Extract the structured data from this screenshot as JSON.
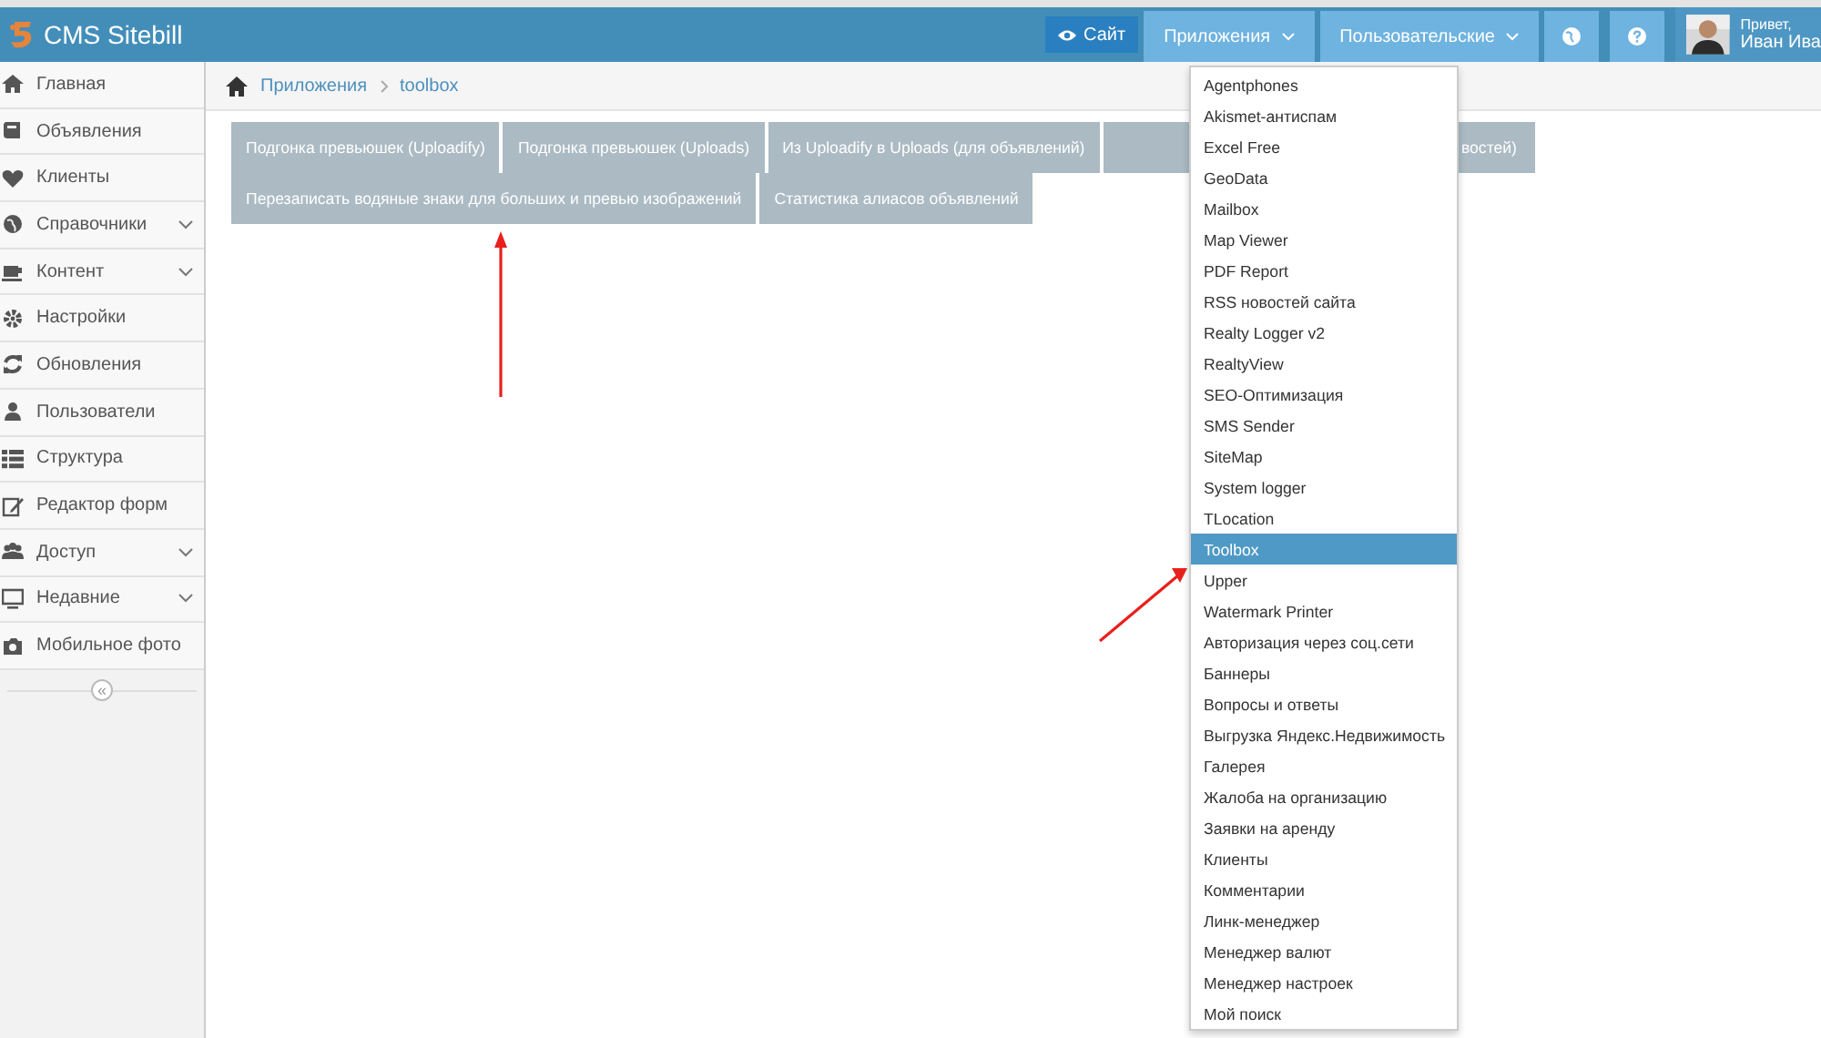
{
  "header": {
    "brand": "CMS Sitebill",
    "site_button": "Сайт",
    "apps_menu": "Приложения",
    "custom_menu": "Пользовательские",
    "greeting": "Привет,",
    "user_name": "Иван Ива"
  },
  "sidebar": {
    "items": [
      {
        "label": "Главная",
        "expandable": false
      },
      {
        "label": "Объявления",
        "expandable": false
      },
      {
        "label": "Клиенты",
        "expandable": false
      },
      {
        "label": "Справочники",
        "expandable": true
      },
      {
        "label": "Контент",
        "expandable": true
      },
      {
        "label": "Настройки",
        "expandable": false
      },
      {
        "label": "Обновления",
        "expandable": false
      },
      {
        "label": "Пользователи",
        "expandable": false
      },
      {
        "label": "Структура",
        "expandable": false
      },
      {
        "label": "Редактор форм",
        "expandable": false
      },
      {
        "label": "Доступ",
        "expandable": true
      },
      {
        "label": "Недавние",
        "expandable": true
      },
      {
        "label": "Мобильное фото",
        "expandable": false
      }
    ],
    "collapse_label": "«"
  },
  "breadcrumb": [
    "Приложения",
    "toolbox"
  ],
  "tool_buttons": [
    "Подгонка превьюшек (Uploadify)",
    "Подгонка превьюшек (Uploads)",
    "Из Uploadify в Uploads (для объявлений)",
    "востей)",
    "Перезаписать водяные знаки для больших и превью изображений",
    "Статистика алиасов объявлений"
  ],
  "apps_dropdown": [
    {
      "label": "Agentphones",
      "selected": false
    },
    {
      "label": "Akismet-антиспам",
      "selected": false
    },
    {
      "label": "Excel Free",
      "selected": false
    },
    {
      "label": "GeoData",
      "selected": false
    },
    {
      "label": "Mailbox",
      "selected": false
    },
    {
      "label": "Map Viewer",
      "selected": false
    },
    {
      "label": "PDF Report",
      "selected": false
    },
    {
      "label": "RSS новостей сайта",
      "selected": false
    },
    {
      "label": "Realty Logger v2",
      "selected": false
    },
    {
      "label": "RealtyView",
      "selected": false
    },
    {
      "label": "SEO-Оптимизация",
      "selected": false
    },
    {
      "label": "SMS Sender",
      "selected": false
    },
    {
      "label": "SiteMap",
      "selected": false
    },
    {
      "label": "System logger",
      "selected": false
    },
    {
      "label": "TLocation",
      "selected": false
    },
    {
      "label": "Toolbox",
      "selected": true
    },
    {
      "label": "Upper",
      "selected": false
    },
    {
      "label": "Watermark Printer",
      "selected": false
    },
    {
      "label": "Авторизация через соц.сети",
      "selected": false
    },
    {
      "label": "Баннеры",
      "selected": false
    },
    {
      "label": "Вопросы и ответы",
      "selected": false
    },
    {
      "label": "Выгрузка Яндекс.Недвижимость",
      "selected": false
    },
    {
      "label": "Галерея",
      "selected": false
    },
    {
      "label": "Жалоба на организацию",
      "selected": false
    },
    {
      "label": "Заявки на аренду",
      "selected": false
    },
    {
      "label": "Клиенты",
      "selected": false
    },
    {
      "label": "Комментарии",
      "selected": false
    },
    {
      "label": "Линк-менеджер",
      "selected": false
    },
    {
      "label": "Менеджер валют",
      "selected": false
    },
    {
      "label": "Менеджер настроек",
      "selected": false
    },
    {
      "label": "Мой поиск",
      "selected": false
    }
  ]
}
